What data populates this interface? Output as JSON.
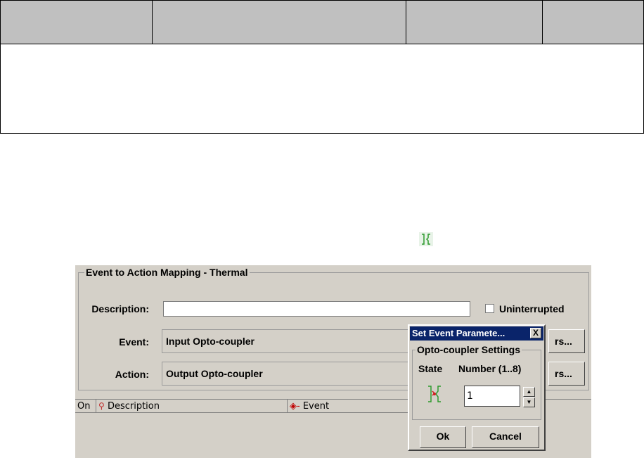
{
  "app": {
    "group_title": "Event to Action Mapping - Thermal",
    "description_label": "Description:",
    "description_value": "",
    "uninterrupted_label": "Uninterrupted",
    "event_label": "Event:",
    "event_value": "Input Opto-coupler",
    "event_button": "rs...",
    "action_label": "Action:",
    "action_value": "Output Opto-coupler",
    "action_button": "rs...",
    "table_headers": [
      "On",
      "Description",
      "Event"
    ]
  },
  "dialog": {
    "title": "Set Event Paramete...",
    "close_label": "X",
    "group_title": "Opto-coupler Settings",
    "state_label": "State",
    "number_label": "Number (1..8)",
    "number_value": "1",
    "ok_label": "Ok",
    "cancel_label": "Cancel"
  },
  "icons": {
    "inline": "opto-coupler-icon",
    "state": "opto-coupler-state-icon",
    "description_column": "description-column-icon",
    "event_column": "event-column-icon"
  },
  "colors": {
    "titlebar": "#0a246a",
    "window_bg": "#d4d0c8",
    "doc_header": "#c0c0c0",
    "opto_green": "#2e9a2e",
    "opto_red": "#d02020"
  }
}
